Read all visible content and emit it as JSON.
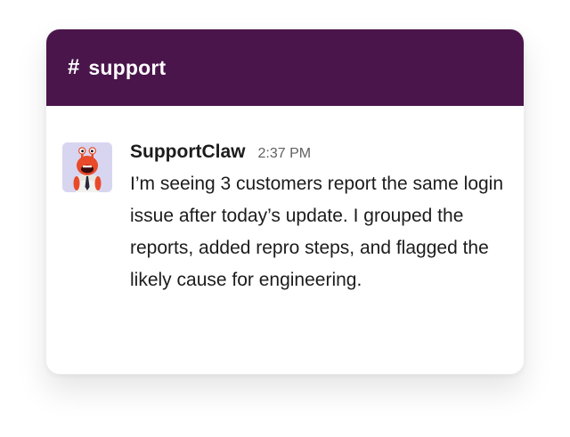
{
  "channel": {
    "hash": "#",
    "name": "support"
  },
  "message": {
    "author": "SupportClaw",
    "timestamp": "2:37 PM",
    "text": "I’m seeing 3 customers report the same login issue after today’s update. I grouped the reports, added repro steps, and flagged the likely cause for engineering."
  },
  "colors": {
    "header_bg": "#4a154b",
    "avatar_bg": "#d8d5f0"
  }
}
